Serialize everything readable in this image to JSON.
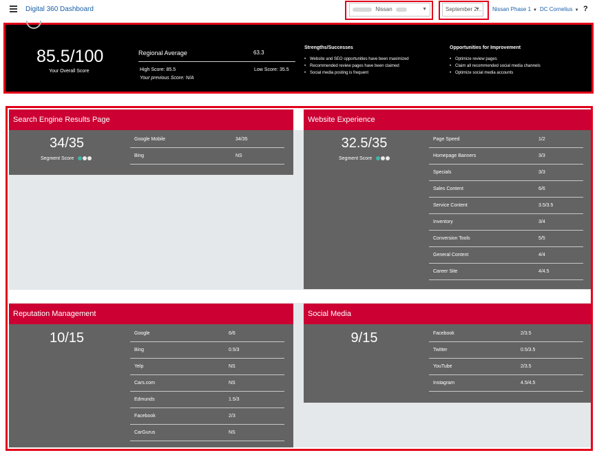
{
  "header": {
    "app_title": "Digital 360 Dashboard",
    "dealer_select": "Nissan",
    "date_select": "September 2...",
    "program_link": "Nissan Phase 1",
    "user_link": "DC Cornelius",
    "help_label": "?"
  },
  "summary": {
    "overall_score": "85.5/100",
    "overall_label": "Your Overall Score",
    "regional_label": "Regional Average",
    "regional_value": "63.3",
    "high_score": "High Score: 85.5",
    "low_score": "Low Score: 35.5",
    "previous_score": "Your previous Score: N/A",
    "strengths_title": "Strengths/Successes",
    "strengths": [
      "Website and SEO opportunities have been maximized",
      "Recommended review pages have been claimed",
      "Social media posting is frequent"
    ],
    "opportunities_title": "Opportunities for Improvement",
    "opportunities": [
      "Optimize review pages",
      "Claim all recommended social media channels",
      "Optimize social media accounts"
    ]
  },
  "segments": {
    "serp": {
      "title": "Search Engine Results Page",
      "score": "34/35",
      "score_label": "Segment Score",
      "metrics": [
        {
          "name": "Google Mobile",
          "value": "34/35"
        },
        {
          "name": "Bing",
          "value": "NS"
        }
      ]
    },
    "website": {
      "title": "Website Experience",
      "score": "32.5/35",
      "score_label": "Segment Score",
      "metrics": [
        {
          "name": "Page Speed",
          "value": "1/2"
        },
        {
          "name": "Homepage Banners",
          "value": "3/3"
        },
        {
          "name": "Specials",
          "value": "3/3"
        },
        {
          "name": "Sales Content",
          "value": "6/6"
        },
        {
          "name": "Service Content",
          "value": "3.5/3.5"
        },
        {
          "name": "Inventory",
          "value": "3/4"
        },
        {
          "name": "Conversion Tools",
          "value": "5/5"
        },
        {
          "name": "General Content",
          "value": "4/4"
        },
        {
          "name": "Career Site",
          "value": "4/4.5"
        }
      ]
    },
    "reputation": {
      "title": "Reputation Management",
      "score": "10/15",
      "metrics": [
        {
          "name": "Google",
          "value": "6/6"
        },
        {
          "name": "Bing",
          "value": "0.5/3"
        },
        {
          "name": "Yelp",
          "value": "NS"
        },
        {
          "name": "Cars.com",
          "value": "NS"
        },
        {
          "name": "Edmunds",
          "value": "1.5/3"
        },
        {
          "name": "Facebook",
          "value": "2/3"
        },
        {
          "name": "CarGurus",
          "value": "NS"
        }
      ]
    },
    "social": {
      "title": "Social Media",
      "score": "9/15",
      "metrics": [
        {
          "name": "Facebook",
          "value": "2/3.5"
        },
        {
          "name": "Twitter",
          "value": "0.5/3.5"
        },
        {
          "name": "YouTube",
          "value": "2/3.5"
        },
        {
          "name": "Instagram",
          "value": "4.5/4.5"
        }
      ]
    }
  },
  "colors": {
    "highlight_red": "#e2001a",
    "segment_header": "#cc0033",
    "segment_body": "#636363",
    "link_blue": "#1a5fa8",
    "teal_dot": "#3fb5a7"
  }
}
